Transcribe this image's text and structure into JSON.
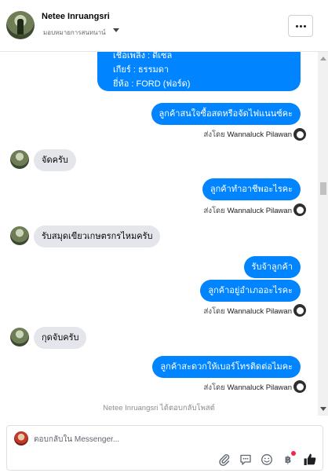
{
  "header": {
    "name": "Netee Inruangsri",
    "subtitle": "มอบหมายการสนทนาน์"
  },
  "thread": {
    "top_bubble_lines": [
      "เชื้อเพลิง : ดีเซล",
      "เกียร์ : ธรรมดา",
      "ยี่ห้อ : FORD (ฟอร์ด)"
    ],
    "messages": [
      {
        "text": "ลูกค้าสนใจซื้อสดหรือจัดไฟแนนซ์คะ"
      },
      {
        "text": "จัดครับ"
      },
      {
        "text": "ลูกค้าทำอาชีพอะไรคะ"
      },
      {
        "text": "รับสมุดเขียวเกษตรกรไหมครับ"
      },
      {
        "text": "รับจ้าลูกค้า"
      },
      {
        "text": "ลูกค้าอยู่อำเภออะไรคะ"
      },
      {
        "text": "กุดจับครับ"
      },
      {
        "text": "ลูกค้าสะดวกให้เบอร์โทรติดต่อไมคะ"
      }
    ],
    "sent_by_prefix": "ส่งโดย",
    "sender": "Wannaluck Pilawan",
    "reply_note": "Netee Inruangsri ได้ตอบกลับโพสต์"
  },
  "composer": {
    "placeholder": "ตอบกลับใน Messenger..."
  },
  "colors": {
    "accent": "#0084ff",
    "incoming": "#e4e6eb"
  }
}
